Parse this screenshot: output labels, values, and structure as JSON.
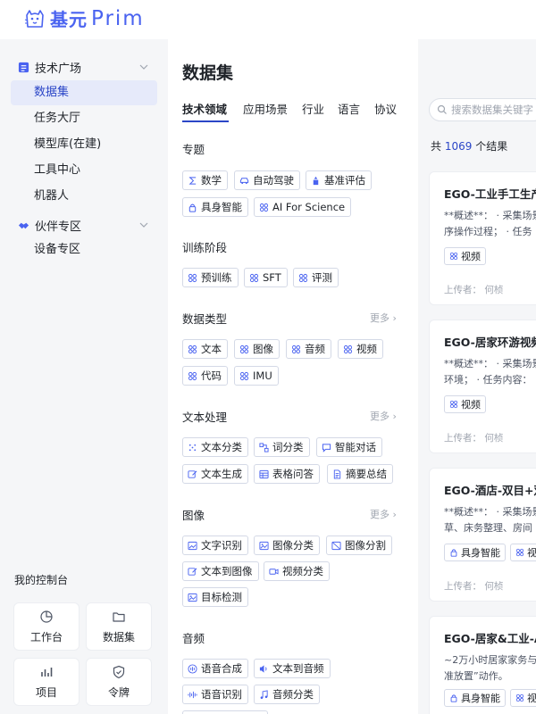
{
  "brand": {
    "name_cn": "基元",
    "name_en": "Prim"
  },
  "sidebar": {
    "group_tech": "技术广场",
    "items_tech": [
      "数据集",
      "任务大厅",
      "模型库(在建)",
      "工具中心",
      "机器人"
    ],
    "group_partner": "伙伴专区",
    "items_partner": [
      "设备专区"
    ],
    "console_title": "我的控制台",
    "console": [
      "工作台",
      "数据集",
      "项目",
      "令牌"
    ]
  },
  "main": {
    "title": "数据集",
    "tabs": [
      "技术领域",
      "应用场景",
      "行业",
      "语言",
      "协议"
    ],
    "search_placeholder": "搜索数据集关键字",
    "more_label": "更多",
    "sections": {
      "topic": {
        "title": "专题",
        "tags": [
          "数学",
          "自动驾驶",
          "基准评估",
          "具身智能",
          "AI For Science"
        ]
      },
      "stage": {
        "title": "训练阶段",
        "tags": [
          "预训练",
          "SFT",
          "评测"
        ]
      },
      "dtype": {
        "title": "数据类型",
        "tags": [
          "文本",
          "图像",
          "音频",
          "视频",
          "代码",
          "IMU"
        ]
      },
      "text": {
        "title": "文本处理",
        "tags": [
          "文本分类",
          "词分类",
          "智能对话",
          "文本生成",
          "表格问答",
          "摘要总结"
        ]
      },
      "image": {
        "title": "图像",
        "tags": [
          "文字识别",
          "图像分类",
          "图像分割",
          "文本到图像",
          "视频分类",
          "目标检测"
        ]
      },
      "audio": {
        "title": "音频",
        "tags": [
          "语音合成",
          "文本到音频",
          "语音识别",
          "音频分类"
        ]
      }
    }
  },
  "results": {
    "prefix": "共",
    "count": "1069",
    "suffix": "个结果",
    "cards": [
      {
        "title": "EGO-工业手工生产",
        "desc1": "**概述**： · 采集场景",
        "desc2": "序操作过程； · 任务",
        "tags": [
          "视频"
        ],
        "uploader": "上传者： 何桢"
      },
      {
        "title": "EGO-居家环游视频",
        "desc1": "**概述**： · 采集场景",
        "desc2": "环境； · 任务内容：",
        "tags": [
          "视频"
        ],
        "uploader": "上传者： 何桢"
      },
      {
        "title": "EGO-酒店-双目+双",
        "desc1": "**概述**： · 采集场景",
        "desc2": "草、床务整理、房间",
        "tags": [
          "具身智能",
          "视频"
        ],
        "uploader": "上传者： 何桢"
      },
      {
        "title": "EGO-居家&工业-A",
        "desc1": "~2万小时居家家务与",
        "desc2": "准放置”动作。",
        "tags": [
          "具身智能",
          "视频"
        ],
        "uploader": ""
      }
    ]
  },
  "colors": {
    "accent": "#2b46c7",
    "brand": "#4a63f0",
    "active_bg": "#e6eafa"
  }
}
